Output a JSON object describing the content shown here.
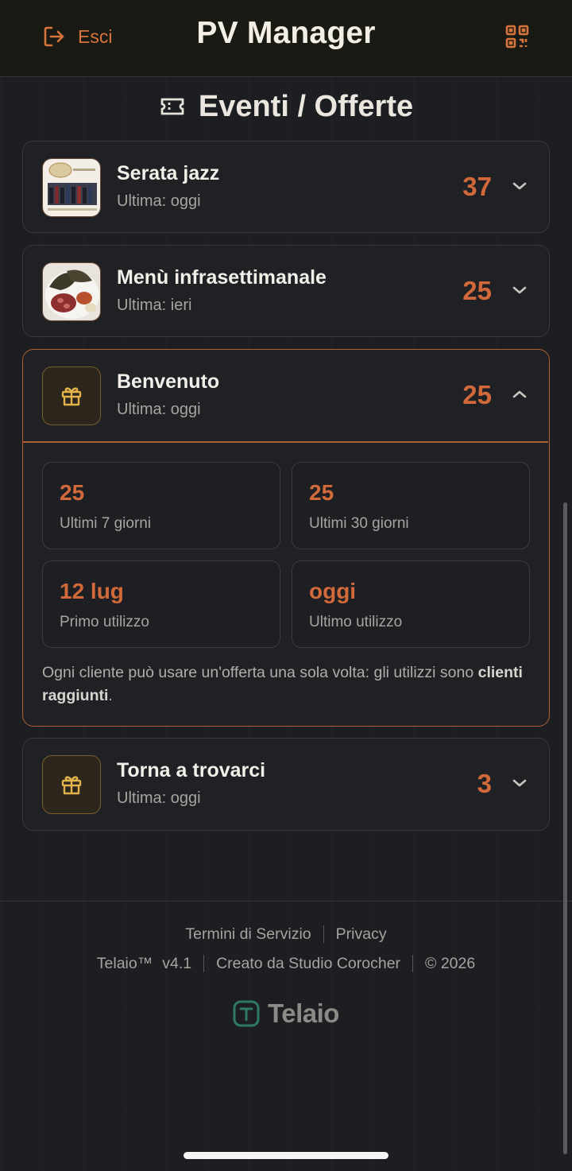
{
  "header": {
    "exit_label": "Esci",
    "app_title": "PV Manager",
    "exit_icon": "logout-icon",
    "qr_icon": "qr-code-icon"
  },
  "section": {
    "title": "Eventi / Offerte",
    "icon": "ticket-icon"
  },
  "offers": [
    {
      "name": "Serata jazz",
      "last": "Ultima: oggi",
      "count": "37",
      "image": "jazz-event-thumbnail",
      "state": "collapsed"
    },
    {
      "name": "Menù infrasettimanale",
      "last": "Ultima: ieri",
      "count": "25",
      "image": "food-plate-thumbnail",
      "state": "collapsed"
    },
    {
      "name": "Benvenuto",
      "last": "Ultima: oggi",
      "count": "25",
      "icon": "gift-icon",
      "state": "expanded",
      "stats": [
        {
          "value": "25",
          "label": "Ultimi 7 giorni"
        },
        {
          "value": "25",
          "label": "Ultimi 30 giorni"
        },
        {
          "value": "12 lug",
          "label": "Primo utilizzo"
        },
        {
          "value": "oggi",
          "label": "Ultimo utilizzo"
        }
      ],
      "note": "Ogni cliente può usare un'offerta una sola volta: gli utilizzi sono ",
      "note_bold": "clienti raggiunti",
      "note_end": "."
    },
    {
      "name": "Torna a trovarci",
      "last": "Ultima: oggi",
      "count": "3",
      "icon": "gift-icon",
      "state": "collapsed"
    }
  ],
  "footer": {
    "terms": "Termini di Servizio",
    "privacy": "Privacy",
    "product": "Telaio™",
    "version": "v4.1",
    "credit": "Creato da Studio Corocher",
    "copyright": "© 2026",
    "brand": "Telaio"
  },
  "colors": {
    "accent": "#d2693a",
    "gift": "#e3b24a",
    "background": "#1c1e22"
  }
}
